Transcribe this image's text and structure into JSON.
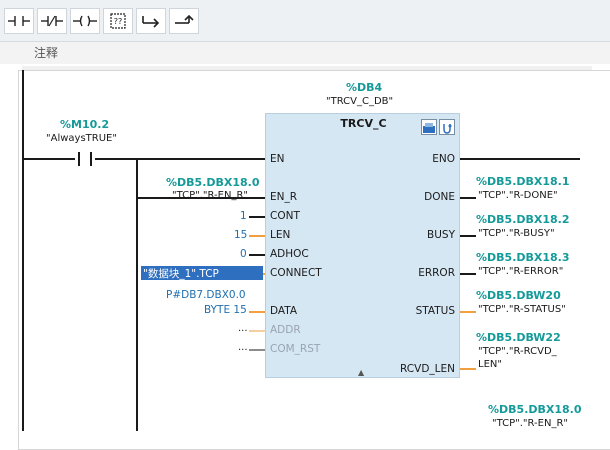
{
  "toolbar": {
    "buttons": [
      {
        "name": "no-contact-button",
        "icon": "contact-no-icon"
      },
      {
        "name": "nc-contact-button",
        "icon": "contact-nc-icon"
      },
      {
        "name": "coil-button",
        "icon": "coil-icon"
      },
      {
        "name": "empty-box-button",
        "icon": "empty-box-icon"
      },
      {
        "name": "open-branch-button",
        "icon": "open-branch-icon"
      },
      {
        "name": "close-branch-button",
        "icon": "close-branch-icon"
      }
    ]
  },
  "comment": {
    "label": "注释"
  },
  "instance_db": {
    "address": "%DB4",
    "symbol": "\"TRCV_C_DB\""
  },
  "contact": {
    "address": "%M10.2",
    "symbol": "\"AlwaysTRUE\""
  },
  "block": {
    "title": "TRCV_C",
    "inputs": [
      {
        "pin": "EN",
        "address": "",
        "value": ""
      },
      {
        "pin": "EN_R",
        "address": "%DB5.DBX18.0",
        "value": "\"TCP\".\"R-EN_R\""
      },
      {
        "pin": "CONT",
        "address": "",
        "value": "1"
      },
      {
        "pin": "LEN",
        "address": "",
        "value": "15"
      },
      {
        "pin": "ADHOC",
        "address": "",
        "value": "0"
      },
      {
        "pin": "CONNECT",
        "address": "",
        "value": "\"数据块_1\".TCP"
      },
      {
        "pin": "DATA",
        "address": "P#DB7.DBX0.0",
        "value": "BYTE 15"
      },
      {
        "pin": "ADDR",
        "address": "",
        "value": "..."
      },
      {
        "pin": "COM_RST",
        "address": "",
        "value": "..."
      }
    ],
    "outputs": [
      {
        "pin": "ENO",
        "address": "",
        "value": ""
      },
      {
        "pin": "DONE",
        "address": "%DB5.DBX18.1",
        "value": "\"TCP\".\"R-DONE\""
      },
      {
        "pin": "BUSY",
        "address": "%DB5.DBX18.2",
        "value": "\"TCP\".\"R-BUSY\""
      },
      {
        "pin": "ERROR",
        "address": "%DB5.DBX18.3",
        "value": "\"TCP\".\"R-ERROR\""
      },
      {
        "pin": "STATUS",
        "address": "%DB5.DBW20",
        "value": "\"TCP\".\"R-STATUS\""
      },
      {
        "pin": "RCVD_LEN",
        "address": "%DB5.DBW22",
        "value": "\"TCP\".\"R-RCVD_",
        "value2": "LEN\""
      }
    ]
  },
  "next_network": {
    "address": "%DB5.DBX18.0",
    "symbol": "\"TCP\".\"R-EN_R\""
  },
  "colors": {
    "address": "#159a9a",
    "value": "#1f6fb0",
    "wire_orange": "#f0a040",
    "block": "#d6e7f4"
  }
}
